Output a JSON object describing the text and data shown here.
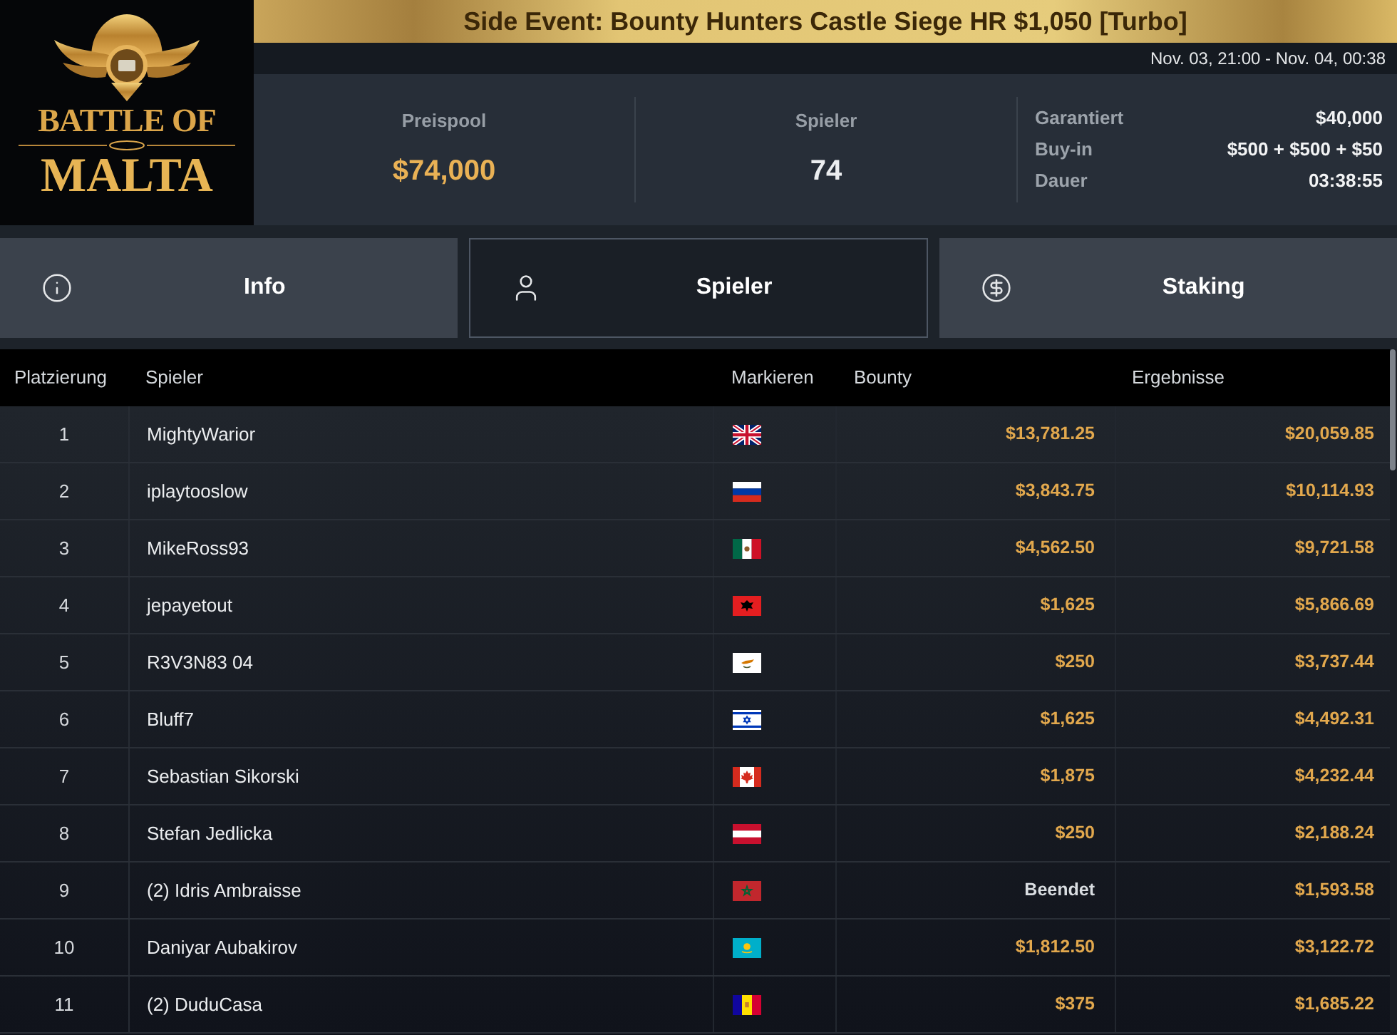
{
  "logo": {
    "line_1": "BATTLE OF",
    "line_2": "MALTA"
  },
  "title": "Side Event: Bounty Hunters Castle Siege HR $1,050 [Turbo]",
  "date_range": "Nov. 03, 21:00 - Nov. 04, 00:38",
  "stats": [
    {
      "label": "Preispool",
      "value": "$74,000",
      "kind": "money"
    },
    {
      "label": "Spieler",
      "value": "74",
      "kind": "count"
    }
  ],
  "details": [
    {
      "label": "Garantiert",
      "value": "$40,000"
    },
    {
      "label": "Buy-in",
      "value": "$500 + $500 + $50"
    },
    {
      "label": "Dauer",
      "value": "03:38:55"
    }
  ],
  "tabs": [
    {
      "label": "Info",
      "kind": "info",
      "selected": false
    },
    {
      "label": "Spieler",
      "kind": "players",
      "selected": true
    },
    {
      "label": "Staking",
      "kind": "staking",
      "selected": false
    }
  ],
  "table": {
    "columns": [
      "Platzierung",
      "Spieler",
      "Markieren",
      "Bounty",
      "Ergebnisse"
    ],
    "rows": [
      {
        "place": "1",
        "player": "MightyWarior",
        "flag": {
          "kind": "uk"
        },
        "bounty": {
          "text": "$13,781.25",
          "kind": "amount"
        },
        "result": "$20,059.85"
      },
      {
        "place": "2",
        "player": "iplaytooslow",
        "flag": {
          "kind": "ru"
        },
        "bounty": {
          "text": "$3,843.75",
          "kind": "amount"
        },
        "result": "$10,114.93"
      },
      {
        "place": "3",
        "player": "MikeRoss93",
        "flag": {
          "kind": "mx"
        },
        "bounty": {
          "text": "$4,562.50",
          "kind": "amount"
        },
        "result": "$9,721.58"
      },
      {
        "place": "4",
        "player": "jepayetout",
        "flag": {
          "kind": "al"
        },
        "bounty": {
          "text": "$1,625",
          "kind": "amount"
        },
        "result": "$5,866.69"
      },
      {
        "place": "5",
        "player": "R3V3N83 04",
        "flag": {
          "kind": "cy"
        },
        "bounty": {
          "text": "$250",
          "kind": "amount"
        },
        "result": "$3,737.44"
      },
      {
        "place": "6",
        "player": "Bluff7",
        "flag": {
          "kind": "il"
        },
        "bounty": {
          "text": "$1,625",
          "kind": "amount"
        },
        "result": "$4,492.31"
      },
      {
        "place": "7",
        "player": "Sebastian Sikorski",
        "flag": {
          "kind": "ca"
        },
        "bounty": {
          "text": "$1,875",
          "kind": "amount"
        },
        "result": "$4,232.44"
      },
      {
        "place": "8",
        "player": "Stefan Jedlicka",
        "flag": {
          "kind": "at"
        },
        "bounty": {
          "text": "$250",
          "kind": "amount"
        },
        "result": "$2,188.24"
      },
      {
        "place": "9",
        "player": "(2) Idris Ambraisse",
        "flag": {
          "kind": "ma"
        },
        "bounty": {
          "text": "Beendet",
          "kind": "status"
        },
        "result": "$1,593.58"
      },
      {
        "place": "10",
        "player": "Daniyar Aubakirov",
        "flag": {
          "kind": "kz"
        },
        "bounty": {
          "text": "$1,812.50",
          "kind": "amount"
        },
        "result": "$3,122.72"
      },
      {
        "place": "11",
        "player": "(2) DuduCasa",
        "flag": {
          "kind": "ad"
        },
        "bounty": {
          "text": "$375",
          "kind": "amount"
        },
        "result": "$1,685.22"
      }
    ]
  }
}
